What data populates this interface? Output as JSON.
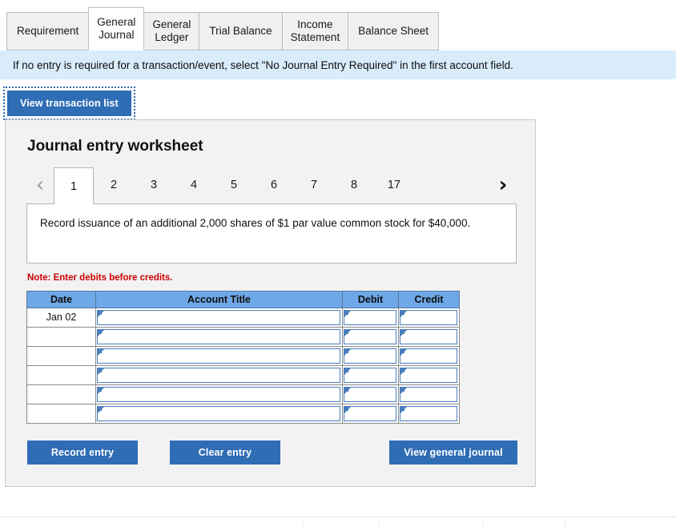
{
  "tabs": [
    {
      "label": "Requirement",
      "lines": [
        "Requirement"
      ],
      "active": false
    },
    {
      "label": "General Journal",
      "lines": [
        "General",
        "Journal"
      ],
      "active": true
    },
    {
      "label": "General Ledger",
      "lines": [
        "General",
        "Ledger"
      ],
      "active": false
    },
    {
      "label": "Trial Balance",
      "lines": [
        "Trial Balance"
      ],
      "active": false
    },
    {
      "label": "Income Statement",
      "lines": [
        "Income",
        "Statement"
      ],
      "active": false
    },
    {
      "label": "Balance Sheet",
      "lines": [
        "Balance Sheet"
      ],
      "active": false
    }
  ],
  "banner": {
    "text": "If no entry is required for a transaction/event, select \"No Journal Entry Required\" in the first account field."
  },
  "toolbar": {
    "view_transaction_list_label": "View transaction list"
  },
  "worksheet": {
    "title": "Journal entry worksheet",
    "pager": {
      "prev_icon": "chevron-left",
      "prev_glyph": "‹",
      "next_icon": "chevron-right",
      "next_glyph": "›",
      "pages": [
        "1",
        "2",
        "3",
        "4",
        "5",
        "6",
        "7",
        "8",
        "17"
      ],
      "active_page": "1"
    },
    "description": "Record issuance of an additional 2,000 shares of $1 par value common stock for $40,000.",
    "note": "Note: Enter debits before credits.",
    "table": {
      "headers": [
        "Date",
        "Account Title",
        "Debit",
        "Credit"
      ],
      "rows": [
        {
          "date": "Jan 02",
          "account": "",
          "debit": "",
          "credit": ""
        },
        {
          "date": "",
          "account": "",
          "debit": "",
          "credit": ""
        },
        {
          "date": "",
          "account": "",
          "debit": "",
          "credit": ""
        },
        {
          "date": "",
          "account": "",
          "debit": "",
          "credit": ""
        },
        {
          "date": "",
          "account": "",
          "debit": "",
          "credit": ""
        },
        {
          "date": "",
          "account": "",
          "debit": "",
          "credit": ""
        }
      ]
    },
    "actions": {
      "record_label": "Record entry",
      "clear_label": "Clear entry",
      "view_journal_label": "View general journal"
    }
  },
  "colors": {
    "button_blue": "#2f6db5",
    "table_header_blue": "#6fa8e8",
    "cell_border_blue": "#4a7ebb",
    "banner_blue": "#d9ecfa",
    "panel_gray": "#f2f2f2",
    "note_red": "#cc0000"
  }
}
